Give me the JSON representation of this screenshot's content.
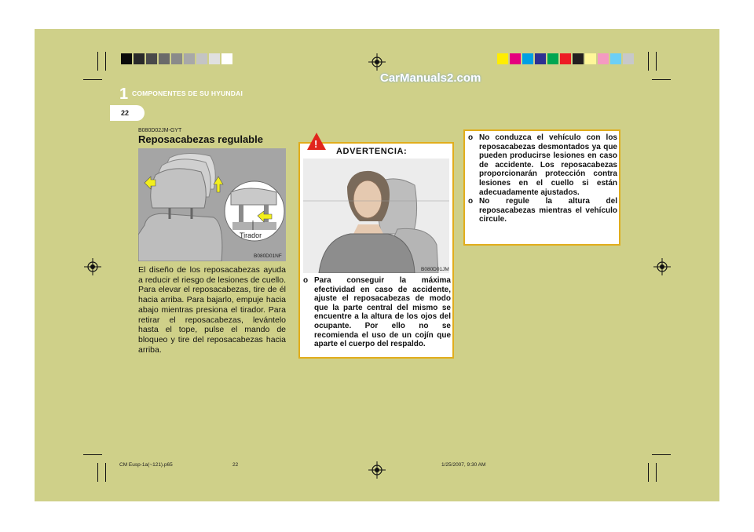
{
  "header": {
    "chapter_number": "1",
    "chapter_title": "COMPONENTES DE SU HYUNDAI",
    "page_number": "22",
    "watermark": "CarManuals2.com"
  },
  "colors": {
    "page_background": "#cfd089",
    "warning_border": "#e1ad1c",
    "gray_swatches": [
      "#0a0a0a",
      "#2a2a2a",
      "#4a4a4a",
      "#6a6a6a",
      "#8a8a8a",
      "#a8a8a8",
      "#c4c4c4",
      "#e0e0e0",
      "#ffffff"
    ],
    "color_swatches": [
      "#ffed00",
      "#e5007e",
      "#00a0e3",
      "#2e3092",
      "#00a651",
      "#ed1c24",
      "#231f20",
      "#fff799",
      "#f49ac1",
      "#6dcff6",
      "#c7c8ca"
    ]
  },
  "section": {
    "code": "B080D02JM-GYT",
    "title": "Reposacabezas regulable",
    "figure_label": "Tirador",
    "figure_code": "B080D01NF",
    "body": "El diseño de los reposacabezas ayuda a reducir el riesgo de lesiones de cuello. Para elevar el reposacabezas, tire de él hacia arriba. Para bajarlo, empuje hacia abajo mientras presiona el tirador. Para retirar el reposacabezas, levántelo hasta el tope, pulse el mando de bloqueo y tire del reposacabezas hacia arriba."
  },
  "warning": {
    "icon": "!",
    "title": "ADVERTENCIA:",
    "figure_code": "B080D01JM",
    "bullet": "o",
    "text": "Para conseguir la máxima efectividad en caso de accidente, ajuste el reposacabezas de modo que la parte central del mismo se encuentre a la altura de los ojos del ocupante. Por ello no se recomienda el uso de un cojín que aparte el cuerpo del respaldo."
  },
  "right_box": {
    "items": [
      {
        "bullet": "o",
        "text": "No conduzca el vehículo con los reposacabezas desmontados ya que pueden producirse lesiones en caso de accidente. Los reposacabezas proporcionarán protección contra lesiones en el cuello si están adecuadamente ajustados."
      },
      {
        "bullet": "o",
        "text": "No regule la altura del reposacabezas mientras el vehículo circule."
      }
    ]
  },
  "footer": {
    "file": "CM Eusp-1a(~121).p65",
    "page": "22",
    "timestamp": "1/25/2007, 9:30 AM"
  },
  "icons": [
    "registration-mark-icon",
    "warning-triangle-icon",
    "arrow-icon"
  ]
}
